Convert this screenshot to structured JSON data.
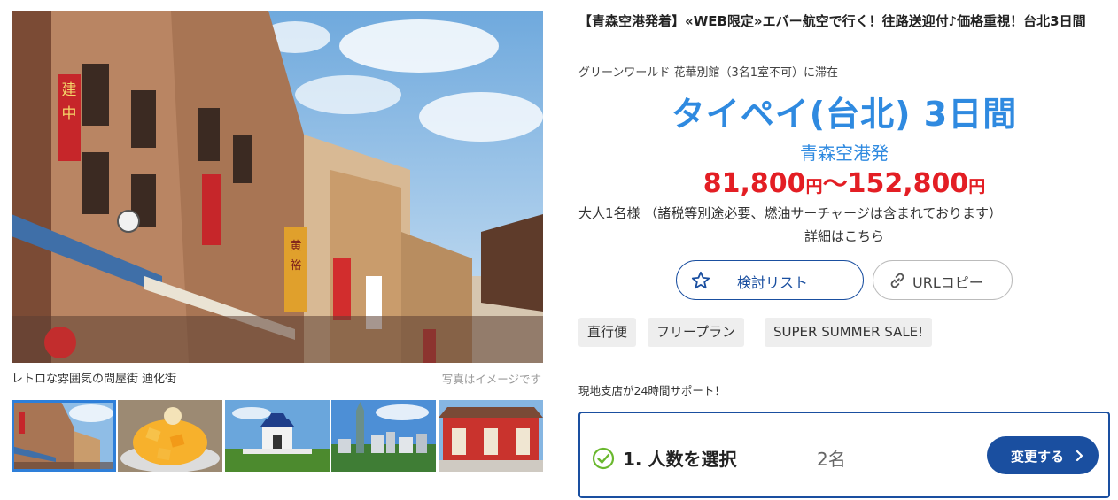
{
  "gallery": {
    "main_caption": "レトロな雰囲気の問屋街 迪化街",
    "image_note": "写真はイメージです",
    "thumbnails": [
      {
        "icon": "street-photo"
      },
      {
        "icon": "mango-shaved-ice-photo"
      },
      {
        "icon": "memorial-hall-photo"
      },
      {
        "icon": "taipei-skyline-photo"
      },
      {
        "icon": "temple-photo"
      }
    ],
    "selected_thumbnail": 1
  },
  "tour": {
    "title": "【青森空港発着】«WEB限定»エバー航空で行く！往路送迎付♪価格重視！台北3日間",
    "stay": "グリーンワールド 花華別館（3名1室不可）に滞在",
    "destination": "タイペイ(台北) 3日間",
    "departure": "青森空港発",
    "price_from": "81,800",
    "price_to": "152,800",
    "currency": "円",
    "price_separator": "～",
    "price_note": "大人1名様 （諸税等別途必要、燃油サーチャージは含まれております）",
    "details_link": "詳細はこちら",
    "accent_color": "#2f8ae0",
    "price_color": "#e31e24"
  },
  "actions": {
    "wishlist_label": "検討リスト",
    "url_copy_label": "URLコピー"
  },
  "tags": [
    "直行便",
    "フリープラン",
    "SUPER SUMMER SALE!"
  ],
  "support_text": "現地支店が24時間サポート！",
  "step": {
    "title": "1. 人数を選択",
    "value": "2名",
    "button_label": "変更する",
    "status_color": "#6ab82e",
    "button_color": "#1a4fa0"
  }
}
